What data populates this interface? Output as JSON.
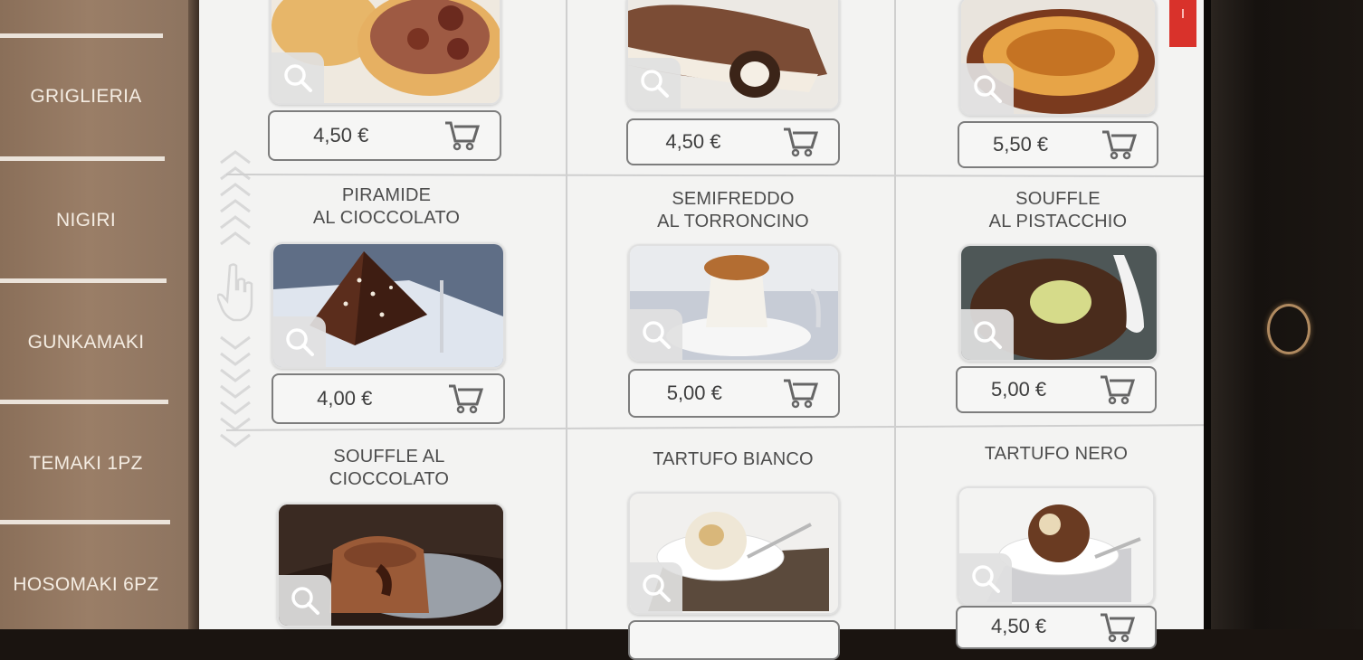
{
  "sidebar": {
    "items": [
      {
        "label": "GRIGLIERIA"
      },
      {
        "label": "NIGIRI"
      },
      {
        "label": "GUNKAMAKI"
      },
      {
        "label": "TEMAKI 1PZ"
      },
      {
        "label": "HOSOMAKI 6PZ"
      }
    ]
  },
  "products": [
    {
      "title": "",
      "price": "4,50 €"
    },
    {
      "title": "",
      "price": "4,50 €"
    },
    {
      "title": "",
      "price": "5,50 €"
    },
    {
      "title": [
        "PIRAMIDE",
        "AL CIOCCOLATO"
      ],
      "price": "4,00 €"
    },
    {
      "title": [
        "SEMIFREDDO",
        "AL TORRONCINO"
      ],
      "price": "5,00 €"
    },
    {
      "title": [
        "SOUFFLE",
        "AL PISTACCHIO"
      ],
      "price": "5,00 €"
    },
    {
      "title": [
        "SOUFFLE AL",
        "CIOCCOLATO"
      ],
      "price": ""
    },
    {
      "title": [
        "TARTUFO BIANCO"
      ],
      "price": ""
    },
    {
      "title": [
        "TARTUFO NERO"
      ],
      "price": "4,50 €"
    }
  ],
  "icons": {
    "zoom": "magnifier-icon",
    "cart": "shopping-cart-icon",
    "scroll_hint": "hand-pointer-icon"
  },
  "colors": {
    "sidebar_bg": "#9a7e67",
    "accent_red": "#d9322b",
    "panel_bg": "#f3f3f2"
  }
}
